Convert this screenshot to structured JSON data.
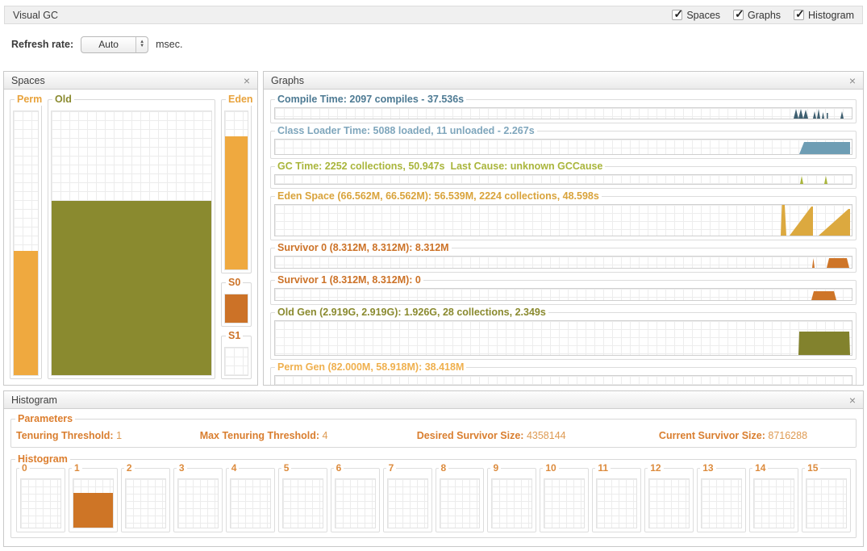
{
  "icons": {
    "close": "×",
    "stepper_up": "▲",
    "stepper_down": "▼"
  },
  "titlebar": {
    "title": "Visual GC",
    "checkboxes": [
      {
        "label": "Spaces",
        "checked": true
      },
      {
        "label": "Graphs",
        "checked": true
      },
      {
        "label": "Histogram",
        "checked": true
      }
    ]
  },
  "refresh": {
    "label": "Refresh rate:",
    "value": "Auto",
    "unit": "msec."
  },
  "spaces": {
    "title": "Spaces",
    "regions": {
      "perm": {
        "label": "Perm",
        "fill_percent": 47,
        "color": "#EFA93F"
      },
      "old": {
        "label": "Old",
        "fill_percent": 66,
        "color": "#8A8A2F"
      },
      "eden": {
        "label": "Eden",
        "fill_percent": 84,
        "color": "#EFA93F"
      },
      "s0": {
        "label": "S0",
        "fill_percent": 100,
        "color": "#CC7227"
      },
      "s1": {
        "label": "S1",
        "fill_percent": 0,
        "color": "#CC7227"
      }
    }
  },
  "graphs": {
    "title": "Graphs",
    "rows": [
      {
        "label": "Compile Time: 2097 compiles - 37.536s",
        "color": "#4D7A93",
        "shape_color": "#3E5F70"
      },
      {
        "label": "Class Loader Time: 5088 loaded, 11 unloaded - 2.267s",
        "color": "#7FA6BC",
        "shape_color": "#6E9DB4"
      },
      {
        "label": "GC Time: 2252 collections, 50.947s  Last Cause: unknown GCCause",
        "color": "#A9B53B",
        "shape_color": "#A9B53B"
      },
      {
        "label": "Eden Space (66.562M, 66.562M): 56.539M, 2224 collections, 48.598s",
        "color": "#D9A33B",
        "shape_color": "#DCA93F"
      },
      {
        "label": "Survivor 0 (8.312M, 8.312M): 8.312M",
        "color": "#CC7227",
        "shape_color": "#CE7528"
      },
      {
        "label": "Survivor 1 (8.312M, 8.312M): 0",
        "color": "#CC7227",
        "shape_color": "#CE7528"
      },
      {
        "label": "Old Gen (2.919G, 2.919G): 1.926G, 28 collections, 2.349s",
        "color": "#8A8A2F",
        "shape_color": "#82822D"
      },
      {
        "label": "Perm Gen (82.000M, 58.918M): 38.418M",
        "color": "#EFB04E",
        "shape_color": "#F3AA3D"
      }
    ]
  },
  "histogram": {
    "title": "Histogram",
    "parameters": {
      "title": "Parameters",
      "items": [
        {
          "label": "Tenuring Threshold: ",
          "value": "1"
        },
        {
          "label": "Max Tenuring Threshold: ",
          "value": "4"
        },
        {
          "label": "Desired Survivor Size: ",
          "value": "4358144"
        },
        {
          "label": "Current Survivor Size: ",
          "value": "8716288"
        }
      ]
    },
    "buckets": {
      "title": "Histogram",
      "fill_color": "#CE7526",
      "cells": [
        {
          "label": "0",
          "fill_percent": 0
        },
        {
          "label": "1",
          "fill_percent": 72
        },
        {
          "label": "2",
          "fill_percent": 0
        },
        {
          "label": "3",
          "fill_percent": 0
        },
        {
          "label": "4",
          "fill_percent": 0
        },
        {
          "label": "5",
          "fill_percent": 0
        },
        {
          "label": "6",
          "fill_percent": 0
        },
        {
          "label": "7",
          "fill_percent": 0
        },
        {
          "label": "8",
          "fill_percent": 0
        },
        {
          "label": "9",
          "fill_percent": 0
        },
        {
          "label": "10",
          "fill_percent": 0
        },
        {
          "label": "11",
          "fill_percent": 0
        },
        {
          "label": "12",
          "fill_percent": 0
        },
        {
          "label": "13",
          "fill_percent": 0
        },
        {
          "label": "14",
          "fill_percent": 0
        },
        {
          "label": "15",
          "fill_percent": 0
        }
      ]
    }
  }
}
